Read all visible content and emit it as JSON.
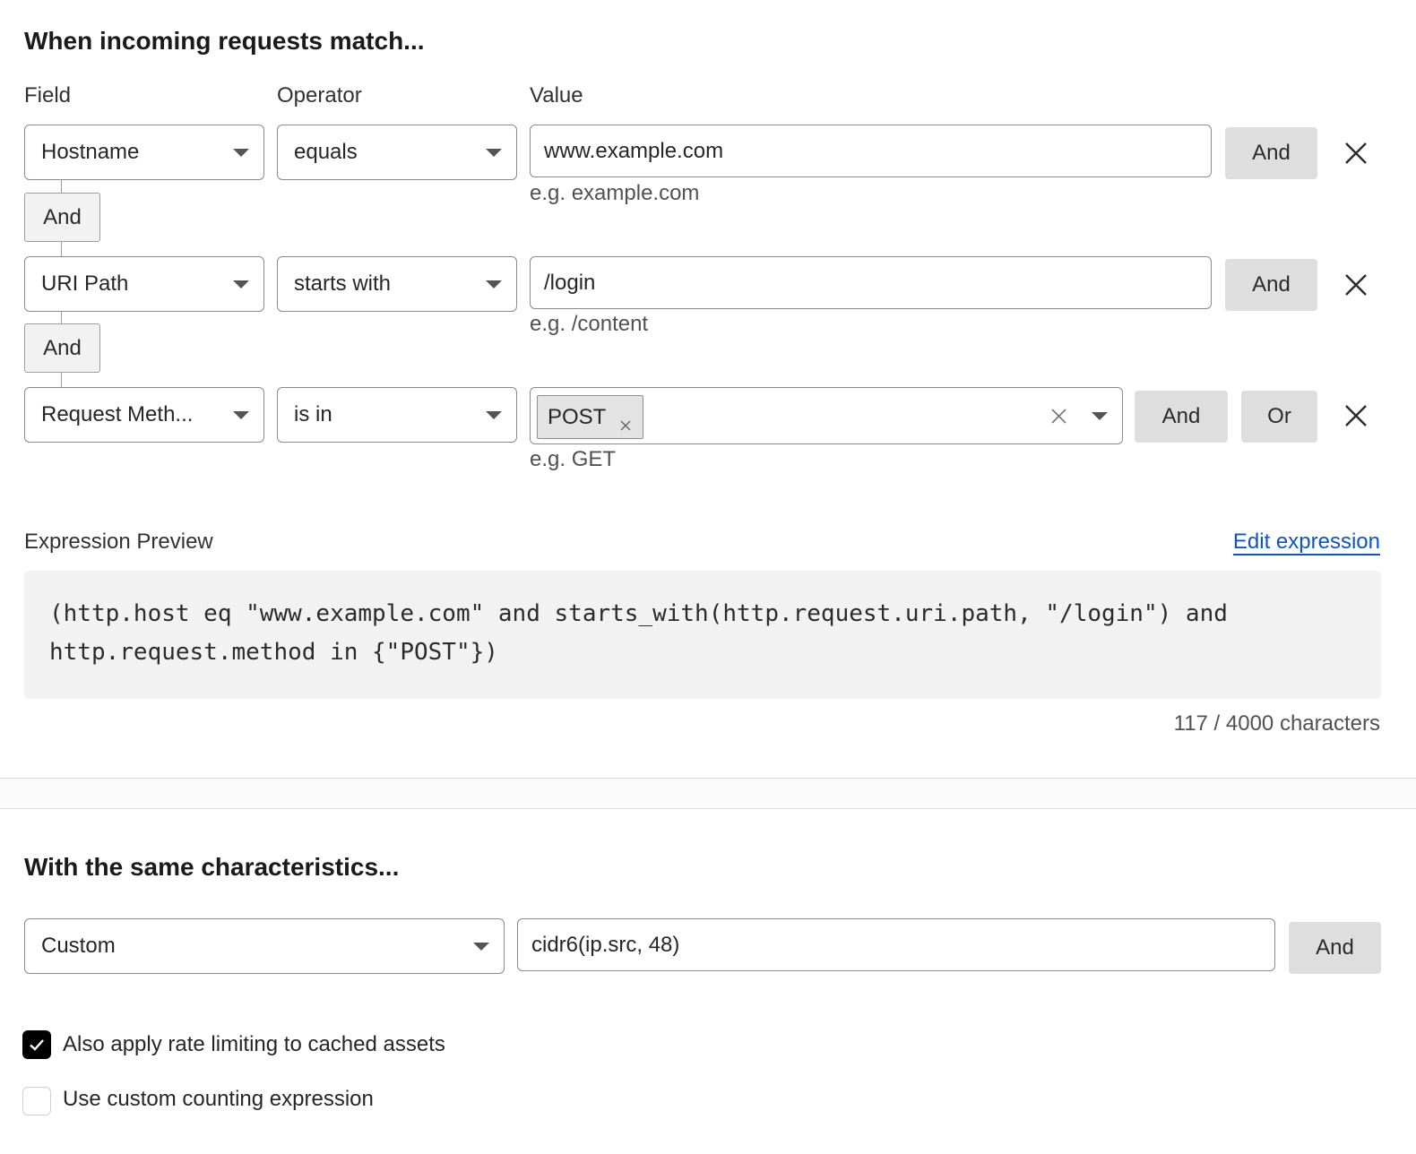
{
  "match_section": {
    "title": "When incoming requests match...",
    "columns": {
      "field": "Field",
      "operator": "Operator",
      "value": "Value"
    },
    "rows": [
      {
        "field": "Hostname",
        "operator": "equals",
        "value": "www.example.com",
        "hint": "e.g. example.com",
        "and_label": "And"
      },
      {
        "field": "URI Path",
        "operator": "starts with",
        "value": "/login",
        "hint": "e.g. /content",
        "and_label": "And"
      },
      {
        "field": "Request Meth...",
        "operator": "is in",
        "tags": [
          "POST"
        ],
        "hint": "e.g. GET",
        "and_label": "And",
        "or_label": "Or"
      }
    ],
    "connectors": [
      "And",
      "And"
    ]
  },
  "expression": {
    "label": "Expression Preview",
    "edit_link": "Edit expression",
    "line1": "(http.host eq \"www.example.com\" and starts_with(http.request.uri.path, \"/login\") and",
    "line2": "http.request.method in {\"POST\"})",
    "char_count": "117 / 4000 characters"
  },
  "characteristics": {
    "title": "With the same characteristics...",
    "select": "Custom",
    "value": "cidr6(ip.src, 48)",
    "and_label": "And"
  },
  "options": [
    {
      "label": "Also apply rate limiting to cached assets",
      "checked": true
    },
    {
      "label": "Use custom counting expression",
      "checked": false
    }
  ],
  "colors": {
    "link": "#0b54c9",
    "button_bg": "#dedede",
    "code_bg": "#f2f2f2",
    "checkbox_on": "#000000"
  },
  "icons": [
    "chevron-down-icon",
    "close-icon",
    "tag-remove-icon",
    "clear-icon",
    "checkmark-icon"
  ]
}
